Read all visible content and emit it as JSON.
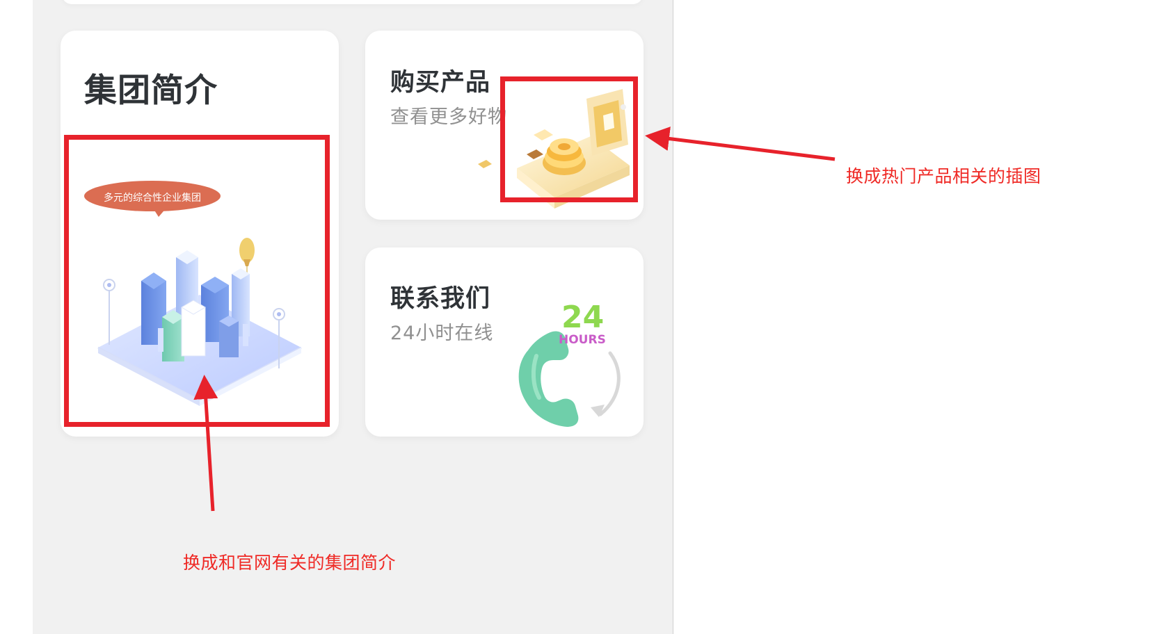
{
  "cards": {
    "company_intro": {
      "title": "集团简介",
      "banner_text": "多元的综合性企业集团",
      "illustration_icon": "city-isometric-illustration"
    },
    "buy_products": {
      "title": "购买产品",
      "subtitle": "查看更多好物",
      "illustration_icon": "golden-cart-illustration"
    },
    "contact_us": {
      "title": "联系我们",
      "subtitle": "24小时在线",
      "hours_number": "24",
      "hours_label": "HOURS",
      "illustration_icon": "phone-receiver-illustration"
    }
  },
  "annotations": {
    "buy_image_note": "换成热门产品相关的插图",
    "intro_image_note": "换成和官网有关的集团简介"
  },
  "colors": {
    "annotation_red": "#e7222b",
    "panel_background": "#f1f1f1",
    "card_background": "#ffffff",
    "building_blue": "#5f86df",
    "building_green": "#72ccb4",
    "badge_orange": "#db6d52",
    "gold": "#f2c966",
    "phone_green": "#6fcfaa",
    "hours_green": "#8ed84f",
    "hours_pink": "#c95cc8"
  }
}
